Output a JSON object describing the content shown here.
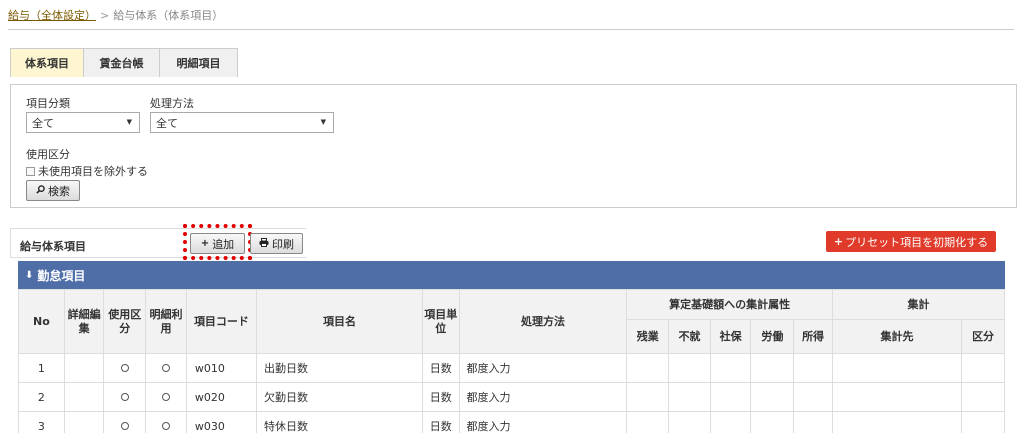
{
  "breadcrumb": {
    "parent": "給与（全体設定）",
    "current": "給与体系（体系項目）"
  },
  "tabs": [
    {
      "label": "体系項目",
      "active": true
    },
    {
      "label": "賃金台帳",
      "active": false
    },
    {
      "label": "明細項目",
      "active": false
    }
  ],
  "filters": {
    "category_label": "項目分類",
    "category_value": "全て",
    "method_label": "処理方法",
    "method_value": "全て",
    "usage_label": "使用区分",
    "exclude_unused_label": "未使用項目を除外する",
    "search_button": "検索",
    "search_icon": "search-icon"
  },
  "list": {
    "title": "給与体系項目",
    "add_button": "追加",
    "print_button": "印刷",
    "reset_button": "プリセット項目を初期化する"
  },
  "section": {
    "title": "勤怠項目"
  },
  "table": {
    "headers": {
      "no": "No",
      "detail_edit": "詳細編集",
      "usage": "使用区分",
      "statement_use": "明細利用",
      "code": "項目コード",
      "name": "項目名",
      "unit": "項目単位",
      "method": "処理方法",
      "calc_group": "算定基礎額への集計属性",
      "overtime": "残業",
      "absence": "不就",
      "social": "社保",
      "labor": "労働",
      "income": "所得",
      "agg_group": "集計",
      "agg_target": "集計先",
      "agg_class": "区分"
    },
    "rows": [
      {
        "no": "1",
        "code": "w010",
        "name": "出勤日数",
        "unit": "日数",
        "method": "都度入力"
      },
      {
        "no": "2",
        "code": "w020",
        "name": "欠勤日数",
        "unit": "日数",
        "method": "都度入力"
      },
      {
        "no": "3",
        "code": "w030",
        "name": "特休日数",
        "unit": "日数",
        "method": "都度入力"
      }
    ]
  },
  "colors": {
    "section_bar": "#4f6ea8",
    "danger_button": "#e03a2a",
    "active_tab": "#fdf6d0",
    "link": "#2a6fc0"
  }
}
